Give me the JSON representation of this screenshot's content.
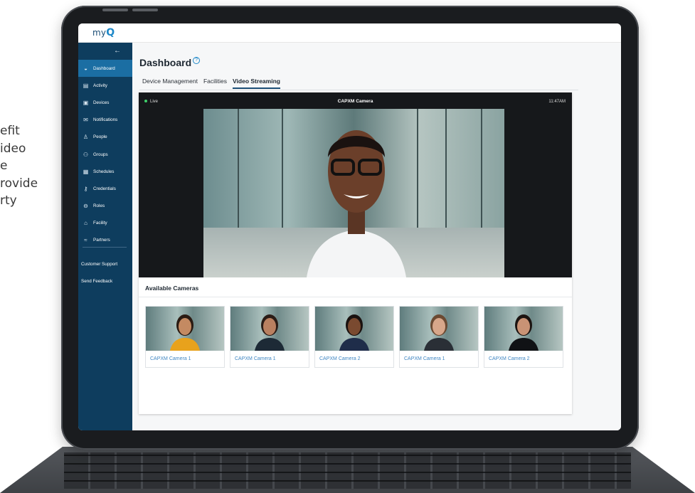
{
  "side_copy": "efit\nideo\ne\nrovide\nrty",
  "app": {
    "logo_text": "my",
    "logo_mark": "Q"
  },
  "sidebar": {
    "collapse_glyph": "←",
    "items": [
      {
        "label": "Dashboard",
        "icon": "dashboard-icon",
        "active": true
      },
      {
        "label": "Activity",
        "icon": "activity-icon"
      },
      {
        "label": "Devices",
        "icon": "devices-icon"
      },
      {
        "label": "Notifications",
        "icon": "envelope-icon"
      },
      {
        "label": "People",
        "icon": "person-icon"
      },
      {
        "label": "Groups",
        "icon": "group-icon"
      },
      {
        "label": "Schedules",
        "icon": "calendar-icon"
      },
      {
        "label": "Credentials",
        "icon": "key-icon"
      },
      {
        "label": "Roles",
        "icon": "role-icon"
      },
      {
        "label": "Facility",
        "icon": "building-icon"
      },
      {
        "label": "Partners",
        "icon": "handshake-icon"
      }
    ],
    "support": "Customer Support",
    "feedback": "Send Feedback"
  },
  "main": {
    "title": "Dashboard",
    "tabs": [
      "Device Management",
      "Facilities",
      "Video Streaming"
    ],
    "active_tab": "Video Streaming"
  },
  "video": {
    "status": "Live",
    "camera_name": "CAPXM Camera",
    "time": "11:47AM"
  },
  "cameras": {
    "title": "Available Cameras",
    "items": [
      {
        "label": "CAPXM Camera 1",
        "person": "woman-yellow"
      },
      {
        "label": "CAPXM Camera 1",
        "person": "man-glasses"
      },
      {
        "label": "CAPXM Camera 2",
        "person": "woman-dots"
      },
      {
        "label": "CAPXM Camera 1",
        "person": "man-beard"
      },
      {
        "label": "CAPXM Camera 2",
        "person": "woman-dark"
      }
    ]
  },
  "colors": {
    "sidebar": "#0e3d5e",
    "sidebar_active": "#1b6ea3",
    "accent": "#1e88c8",
    "link": "#3f86c2",
    "live": "#3ecf6a"
  }
}
